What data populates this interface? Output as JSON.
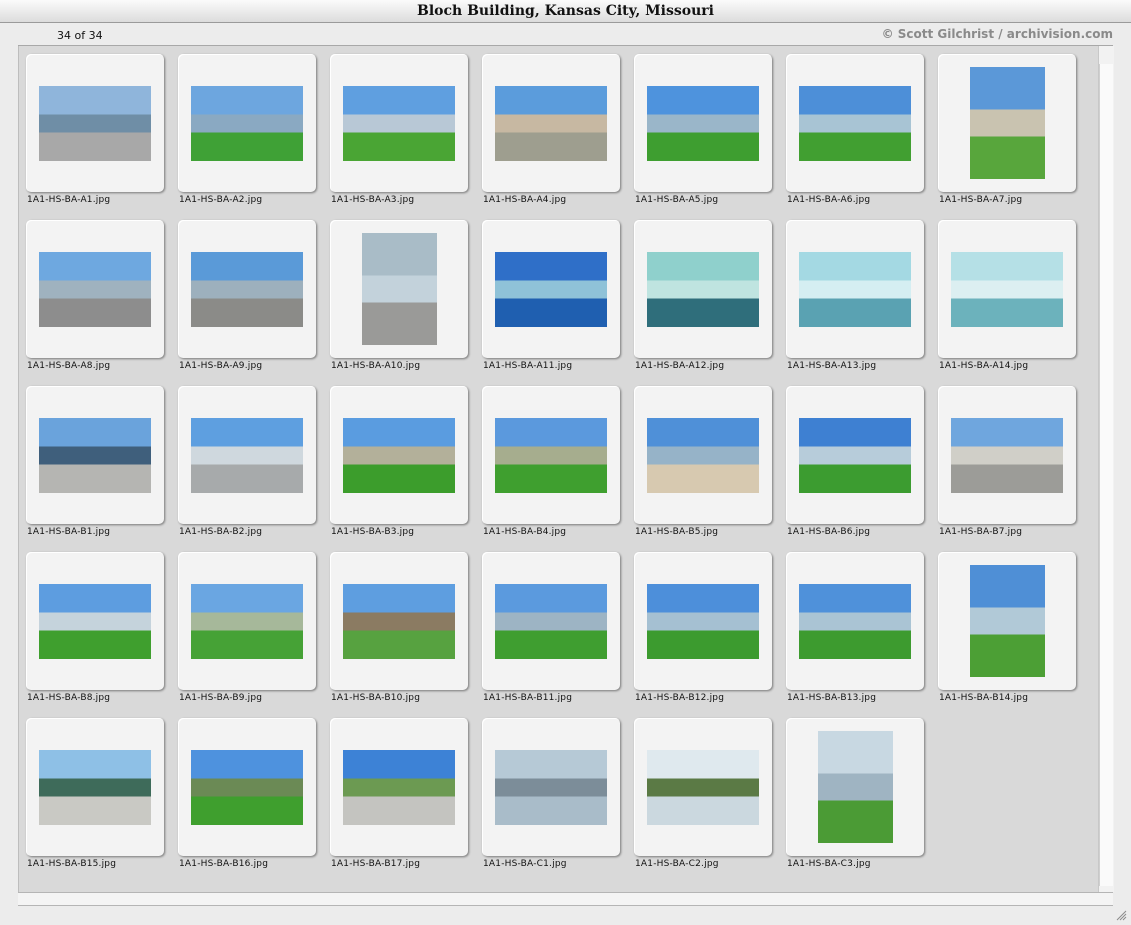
{
  "window": {
    "title": "Bloch Building, Kansas City, Missouri"
  },
  "header": {
    "count": "34 of 34",
    "credit": "© Scott Gilchrist / archivision.com"
  },
  "thumbnails": [
    {
      "file": "1A1-HS-BA-A1.jpg",
      "shape": "land",
      "sky": "#8fb5db",
      "ground": "#a8a8a8",
      "mid": "#6f8ea6"
    },
    {
      "file": "1A1-HS-BA-A2.jpg",
      "shape": "land",
      "sky": "#6da6df",
      "ground": "#3fa136",
      "mid": "#8aa9c2"
    },
    {
      "file": "1A1-HS-BA-A3.jpg",
      "shape": "land",
      "sky": "#5f9fe0",
      "ground": "#4aa534",
      "mid": "#b8c8d6"
    },
    {
      "file": "1A1-HS-BA-A4.jpg",
      "shape": "land",
      "sky": "#5b9cdc",
      "ground": "#9e9e8f",
      "mid": "#c7b8a2"
    },
    {
      "file": "1A1-HS-BA-A5.jpg",
      "shape": "land",
      "sky": "#4e93dd",
      "ground": "#3e9e30",
      "mid": "#9ab6c9"
    },
    {
      "file": "1A1-HS-BA-A6.jpg",
      "shape": "land",
      "sky": "#4d8fd8",
      "ground": "#419f31",
      "mid": "#a8c4d4"
    },
    {
      "file": "1A1-HS-BA-A7.jpg",
      "shape": "port",
      "sky": "#5b98d8",
      "ground": "#58a63c",
      "mid": "#c9c3b0"
    },
    {
      "file": "1A1-HS-BA-A8.jpg",
      "shape": "land",
      "sky": "#6ea8e0",
      "ground": "#8d8d8d",
      "mid": "#9fb2bf"
    },
    {
      "file": "1A1-HS-BA-A9.jpg",
      "shape": "land",
      "sky": "#5a9ad8",
      "ground": "#8b8b88",
      "mid": "#9db0bd"
    },
    {
      "file": "1A1-HS-BA-A10.jpg",
      "shape": "port",
      "sky": "#a9bcc7",
      "ground": "#9a9a98",
      "mid": "#c3d2db"
    },
    {
      "file": "1A1-HS-BA-A11.jpg",
      "shape": "land",
      "sky": "#2f6fc8",
      "ground": "#1f5fb0",
      "mid": "#8fc2d8"
    },
    {
      "file": "1A1-HS-BA-A12.jpg",
      "shape": "land",
      "sky": "#8fd0cc",
      "ground": "#2f6e7b",
      "mid": "#bfe4e0"
    },
    {
      "file": "1A1-HS-BA-A13.jpg",
      "shape": "land",
      "sky": "#a4d9e3",
      "ground": "#5aa2b2",
      "mid": "#d5eef2"
    },
    {
      "file": "1A1-HS-BA-A14.jpg",
      "shape": "land",
      "sky": "#b5e0e6",
      "ground": "#6cb2bc",
      "mid": "#dceff1"
    },
    {
      "file": "1A1-HS-BA-B1.jpg",
      "shape": "land",
      "sky": "#6aa3dc",
      "ground": "#b5b5b2",
      "mid": "#3f5f7c"
    },
    {
      "file": "1A1-HS-BA-B2.jpg",
      "shape": "land",
      "sky": "#5e9fe0",
      "ground": "#a7aaab",
      "mid": "#cfd8de"
    },
    {
      "file": "1A1-HS-BA-B3.jpg",
      "shape": "land",
      "sky": "#5a9ce0",
      "ground": "#3c9d2c",
      "mid": "#b3b09a"
    },
    {
      "file": "1A1-HS-BA-B4.jpg",
      "shape": "land",
      "sky": "#5b99dd",
      "ground": "#3f9f2f",
      "mid": "#a6ad8e"
    },
    {
      "file": "1A1-HS-BA-B5.jpg",
      "shape": "land",
      "sky": "#4f90d8",
      "ground": "#d7c9b0",
      "mid": "#96b3c8"
    },
    {
      "file": "1A1-HS-BA-B6.jpg",
      "shape": "land",
      "sky": "#3e80d2",
      "ground": "#3c9c30",
      "mid": "#b7ccda"
    },
    {
      "file": "1A1-HS-BA-B7.jpg",
      "shape": "land",
      "sky": "#6fa6de",
      "ground": "#9c9c98",
      "mid": "#d0cfc8"
    },
    {
      "file": "1A1-HS-BA-B8.jpg",
      "shape": "land",
      "sky": "#5d9de0",
      "ground": "#3f9f2e",
      "mid": "#c5d3dc"
    },
    {
      "file": "1A1-HS-BA-B9.jpg",
      "shape": "land",
      "sky": "#6aa6e2",
      "ground": "#46a236",
      "mid": "#a6b89a"
    },
    {
      "file": "1A1-HS-BA-B10.jpg",
      "shape": "land",
      "sky": "#5e9ee0",
      "ground": "#57a240",
      "mid": "#8b7b62"
    },
    {
      "file": "1A1-HS-BA-B11.jpg",
      "shape": "land",
      "sky": "#5b9ade",
      "ground": "#3f9e30",
      "mid": "#9db4c4"
    },
    {
      "file": "1A1-HS-BA-B12.jpg",
      "shape": "land",
      "sky": "#4d8fda",
      "ground": "#3c9b2f",
      "mid": "#a5c0d2"
    },
    {
      "file": "1A1-HS-BA-B13.jpg",
      "shape": "land",
      "sky": "#4f91da",
      "ground": "#3d9b2f",
      "mid": "#aac4d4"
    },
    {
      "file": "1A1-HS-BA-B14.jpg",
      "shape": "port",
      "sky": "#4f8fd6",
      "ground": "#4c9f35",
      "mid": "#b1c9d7"
    },
    {
      "file": "1A1-HS-BA-B15.jpg",
      "shape": "land",
      "sky": "#8ec0e6",
      "ground": "#c9c9c4",
      "mid": "#3e6b5a"
    },
    {
      "file": "1A1-HS-BA-B16.jpg",
      "shape": "land",
      "sky": "#4e92de",
      "ground": "#3f9f2e",
      "mid": "#6b8a55"
    },
    {
      "file": "1A1-HS-BA-B17.jpg",
      "shape": "land",
      "sky": "#3d82d6",
      "ground": "#c4c4c0",
      "mid": "#6c9a52"
    },
    {
      "file": "1A1-HS-BA-C1.jpg",
      "shape": "land",
      "sky": "#b6c9d6",
      "ground": "#a9bcc9",
      "mid": "#7c8d99"
    },
    {
      "file": "1A1-HS-BA-C2.jpg",
      "shape": "land",
      "sky": "#dfe9ee",
      "ground": "#cbd8df",
      "mid": "#5b7a45"
    },
    {
      "file": "1A1-HS-BA-C3.jpg",
      "shape": "port",
      "sky": "#c8d8e2",
      "ground": "#4b9b35",
      "mid": "#9fb4c2"
    }
  ]
}
